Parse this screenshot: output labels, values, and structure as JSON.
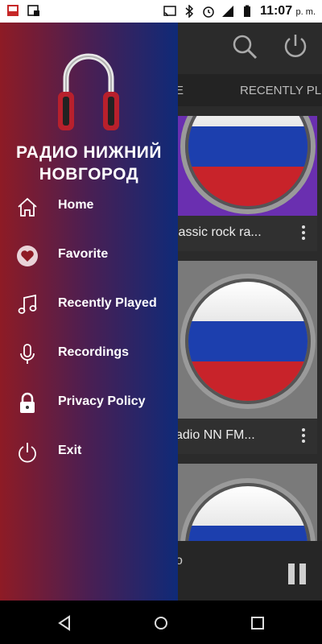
{
  "status_bar": {
    "time": "11:07",
    "ampm": "p. m.",
    "icons": [
      "app-notification-icon",
      "picture-in-picture-icon",
      "cast-icon",
      "bluetooth-icon",
      "alarm-icon",
      "signal-icon",
      "battery-icon"
    ]
  },
  "drawer": {
    "title_line1": "РАДИО НИЖНИЙ",
    "title_line2": "НОВГОРОД",
    "items": [
      {
        "label": "Home",
        "icon": "home-icon"
      },
      {
        "label": "Favorite",
        "icon": "heart-icon"
      },
      {
        "label": "Recently Played",
        "icon": "music-note-icon"
      },
      {
        "label": "Recordings",
        "icon": "microphone-icon"
      },
      {
        "label": "Privacy Policy",
        "icon": "lock-icon"
      },
      {
        "label": "Exit",
        "icon": "power-icon"
      }
    ]
  },
  "app": {
    "tabs": [
      "E",
      "RECENTLY PL"
    ],
    "cards": [
      {
        "caption": "lassic rock ra..."
      },
      {
        "caption": "adio NN FM..."
      },
      {
        "caption": "o"
      }
    ]
  },
  "colors": {
    "drawer_left": "#8e1b25",
    "drawer_right": "#0f2a78",
    "flag_white": "#ffffff",
    "flag_blue": "#1c3fae",
    "flag_red": "#c8232a"
  }
}
